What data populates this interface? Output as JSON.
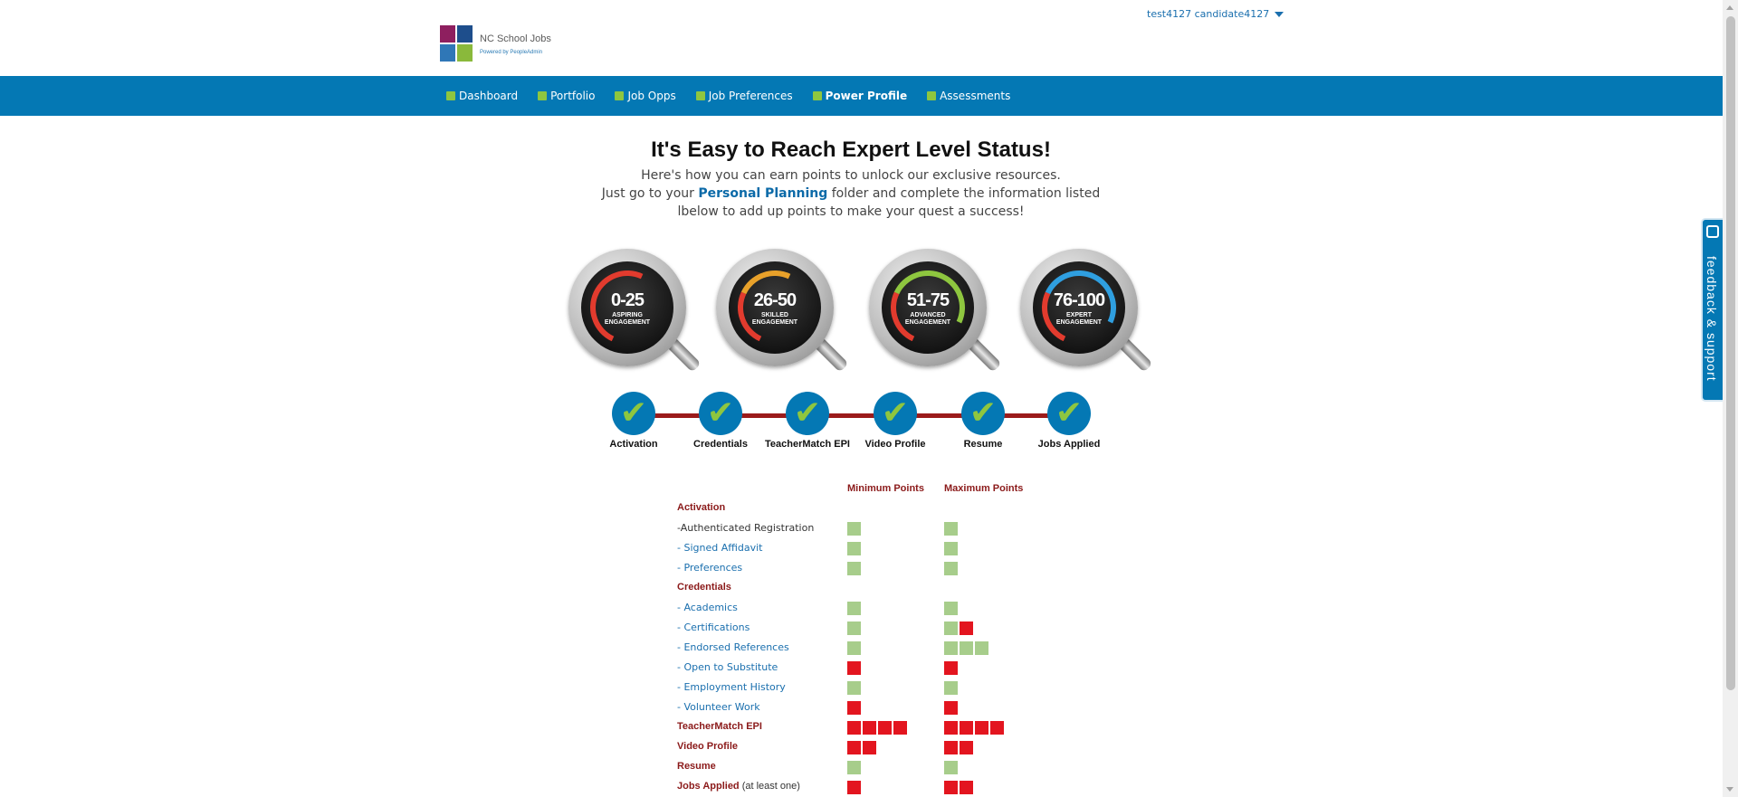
{
  "header": {
    "logo_title": "NC School Jobs",
    "logo_sub": "Powered by PeopleAdmin",
    "user_name": "test4127 candidate4127"
  },
  "nav": {
    "items": [
      {
        "label": "Dashboard",
        "active": false
      },
      {
        "label": "Portfolio",
        "active": false
      },
      {
        "label": "Job Opps",
        "active": false
      },
      {
        "label": "Job Preferences",
        "active": false
      },
      {
        "label": "Power Profile",
        "active": true
      },
      {
        "label": "Assessments",
        "active": false
      }
    ]
  },
  "feedback": {
    "label": "feedback & support"
  },
  "hero": {
    "title": "It's Easy to Reach Expert Level Status!",
    "line1": "Here's how you can earn points to unlock our exclusive resources.",
    "line2_pre": "Just go to your ",
    "line2_link": "Personal Planning",
    "line2_post": " folder and complete the information listed",
    "line3": "lbelow to add up points to make your quest a success!"
  },
  "gauges": [
    {
      "range": "0-25",
      "label1": "ASPIRING",
      "label2": "ENGAGEMENT"
    },
    {
      "range": "26-50",
      "label1": "SKILLED",
      "label2": "ENGAGEMENT"
    },
    {
      "range": "51-75",
      "label1": "ADVANCED",
      "label2": "ENGAGEMENT"
    },
    {
      "range": "76-100",
      "label1": "EXPERT",
      "label2": "ENGAGEMENT"
    }
  ],
  "steps": [
    {
      "label": "Activation",
      "done": true
    },
    {
      "label": "Credentials",
      "done": true
    },
    {
      "label": "TeacherMatch EPI",
      "done": true
    },
    {
      "label": "Video Profile",
      "done": true
    },
    {
      "label": "Resume",
      "done": true
    },
    {
      "label": "Jobs Applied",
      "done": true
    }
  ],
  "table": {
    "min_header": "Minimum Points",
    "max_header": "Maximum Points",
    "rows": [
      {
        "label": "Activation",
        "kind": "section",
        "min": [],
        "max": []
      },
      {
        "label": "-Authenticated Registration",
        "kind": "plain",
        "min": [
          "g"
        ],
        "max": [
          "g"
        ]
      },
      {
        "label": "- Signed Affidavit",
        "kind": "link",
        "min": [
          "g"
        ],
        "max": [
          "g"
        ]
      },
      {
        "label": "- Preferences",
        "kind": "link",
        "min": [
          "g"
        ],
        "max": [
          "g"
        ]
      },
      {
        "label": "Credentials",
        "kind": "section",
        "min": [],
        "max": []
      },
      {
        "label": "- Academics",
        "kind": "link",
        "min": [
          "g"
        ],
        "max": [
          "g"
        ]
      },
      {
        "label": "- Certifications",
        "kind": "link",
        "min": [
          "g"
        ],
        "max": [
          "g",
          "r"
        ]
      },
      {
        "label": "- Endorsed References",
        "kind": "link",
        "min": [
          "g"
        ],
        "max": [
          "g",
          "g",
          "g"
        ]
      },
      {
        "label": "- Open to Substitute",
        "kind": "link",
        "min": [
          "r"
        ],
        "max": [
          "r"
        ]
      },
      {
        "label": "- Employment History",
        "kind": "link",
        "min": [
          "g"
        ],
        "max": [
          "g"
        ]
      },
      {
        "label": "- Volunteer Work",
        "kind": "link",
        "min": [
          "r"
        ],
        "max": [
          "r"
        ]
      },
      {
        "label": "TeacherMatch EPI",
        "kind": "section",
        "min": [
          "r",
          "r",
          "r",
          "r"
        ],
        "max": [
          "r",
          "r",
          "r",
          "r"
        ]
      },
      {
        "label": "Video Profile",
        "kind": "section",
        "min": [
          "r",
          "r"
        ],
        "max": [
          "r",
          "r"
        ]
      },
      {
        "label": "Resume",
        "kind": "section",
        "min": [
          "g"
        ],
        "max": [
          "g"
        ]
      },
      {
        "label": "Jobs Applied",
        "kind": "section",
        "note": " (at least one)",
        "min": [
          "r"
        ],
        "max": [
          "r",
          "r"
        ]
      }
    ]
  }
}
